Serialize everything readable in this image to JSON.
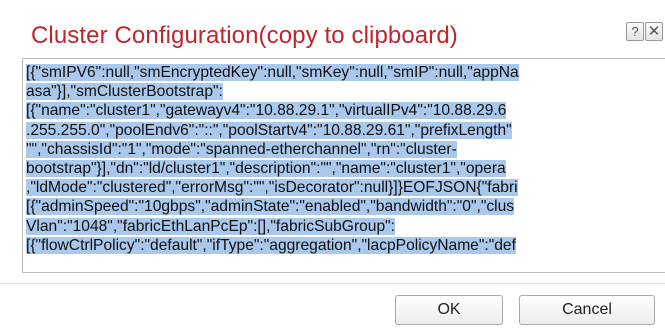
{
  "dialog": {
    "title": "Cluster Configuration(copy to clipboard)",
    "help_label": "?",
    "close_label": "✕",
    "ok_label": "OK",
    "cancel_label": "Cancel"
  },
  "text_lines": [
    "[{\"smIPV6\":null,\"smEncryptedKey\":null,\"smKey\":null,\"smIP\":null,\"appNa",
    "asa\"}],\"smClusterBootstrap\":",
    "[{\"name\":\"cluster1\",\"gatewayv4\":\"10.88.29.1\",\"virtualIPv4\":\"10.88.29.6",
    ".255.255.0\",\"poolEndv6\":\"::\",\"poolStartv4\":\"10.88.29.61\",\"prefixLength\"",
    "\"\",\"chassisId\":\"1\",\"mode\":\"spanned-etherchannel\",\"rn\":\"cluster-",
    "bootstrap\"}],\"dn\":\"ld/cluster1\",\"description\":\"\",\"name\":\"cluster1\",\"opera",
    ",\"ldMode\":\"clustered\",\"errorMsg\":\"\",\"isDecorator\":null}]}EOFJSON{\"fabri",
    "[{\"adminSpeed\":\"10gbps\",\"adminState\":\"enabled\",\"bandwidth\":\"0\",\"clus",
    "Vlan\":\"1048\",\"fabricEthLanPcEp\":[],\"fabricSubGroup\":",
    "[{\"flowCtrlPolicy\":\"default\",\"ifType\":\"aggregation\",\"lacpPolicyName\":\"def"
  ],
  "colors": {
    "title": "#c0242c",
    "selection": "#a9c8ec"
  }
}
